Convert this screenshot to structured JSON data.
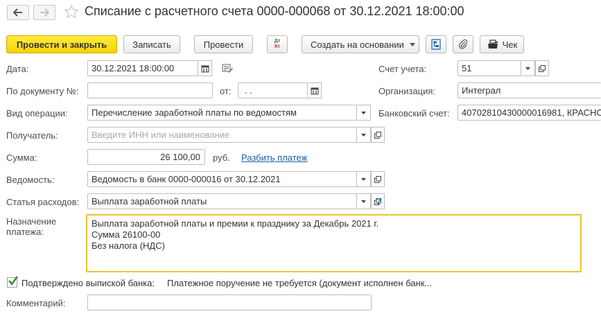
{
  "window": {
    "title": "Списание с расчетного счета 0000-000068 от 30.12.2021 18:00:00"
  },
  "toolbar": {
    "post_and_close": "Провести и закрыть",
    "save": "Записать",
    "post": "Провести",
    "dt_kt_top": "Дт",
    "dt_kt_bottom": "Кт",
    "create_based_on": "Создать на основании",
    "receipt": "Чек"
  },
  "form": {
    "date_label": "Дата:",
    "date_value": "30.12.2021 18:00:00",
    "doc_number_label": "По документу №:",
    "doc_number_value": "",
    "from_label": "от:",
    "from_value": " .  .",
    "operation_type_label": "Вид операции:",
    "operation_type_value": "Перечисление заработной платы по ведомостям",
    "recipient_label": "Получатель:",
    "recipient_placeholder": "Введите ИНН или наименование",
    "sum_label": "Сумма:",
    "sum_value": "26 100,00",
    "currency": "руб.",
    "split_payment": "Разбить платеж",
    "statement_label": "Ведомость:",
    "statement_value": "Ведомость в банк 0000-000016 от 30.12.2021",
    "expense_item_label": "Статья расходов:",
    "expense_item_value": "Выплата заработной платы",
    "help": "?",
    "purpose_label_1": "Назначение",
    "purpose_label_2": "платежа:",
    "purpose_lines": [
      "Выплата  заработной платы и премии к празднику за Декабрь 2021 г.",
      "Сумма 26100-00",
      "Без налога (НДС)"
    ],
    "confirmed_label": "Подтверждено выпиской банка:",
    "confirmed_checked": true,
    "payment_order_note": "Платежное поручение не требуется (документ исполнен банк...",
    "comment_label": "Комментарий:",
    "comment_value": "",
    "account_label": "Счет учета:",
    "account_value": "51",
    "organization_label": "Организация:",
    "organization_value": "Интеграл",
    "bank_account_label": "Банковский счет:",
    "bank_account_value": "40702810430000016981, КРАСНО"
  },
  "colors": {
    "primary_button": "#f5d300",
    "link": "#1a5fa8",
    "memo_border": "#f0c230",
    "check_mark": "#2e8b2e"
  }
}
